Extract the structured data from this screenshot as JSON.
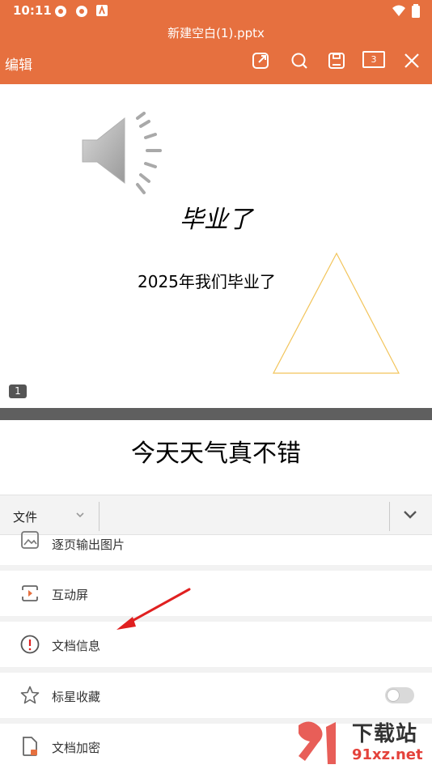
{
  "status_bar": {
    "time": "10:11"
  },
  "header": {
    "doc_title": "新建空白(1).pptx",
    "edit_label": "编辑",
    "page_count": "3",
    "icons": [
      "share-icon",
      "search-icon",
      "save-icon",
      "page-count-icon",
      "close-icon"
    ]
  },
  "slides": [
    {
      "number": "1",
      "title": "毕业了",
      "subtitle": "2025年我们毕业了"
    },
    {
      "title": "今天天气真不错"
    }
  ],
  "menu_bar": {
    "tab_label": "文件"
  },
  "menu_items": [
    {
      "label": "逐页输出图片",
      "icon": "image-export-icon"
    },
    {
      "label": "互动屏",
      "icon": "interactive-screen-icon"
    },
    {
      "label": "文档信息",
      "icon": "info-icon"
    },
    {
      "label": "标星收藏",
      "icon": "star-icon",
      "toggle_on": false
    },
    {
      "label": "文档加密",
      "icon": "document-lock-icon"
    }
  ],
  "watermark": {
    "brand": "下载站",
    "domain": "91xz.net"
  },
  "colors": {
    "accent": "#E6703F",
    "annotation_arrow": "#E02020",
    "triangle": "#F2C45A"
  }
}
